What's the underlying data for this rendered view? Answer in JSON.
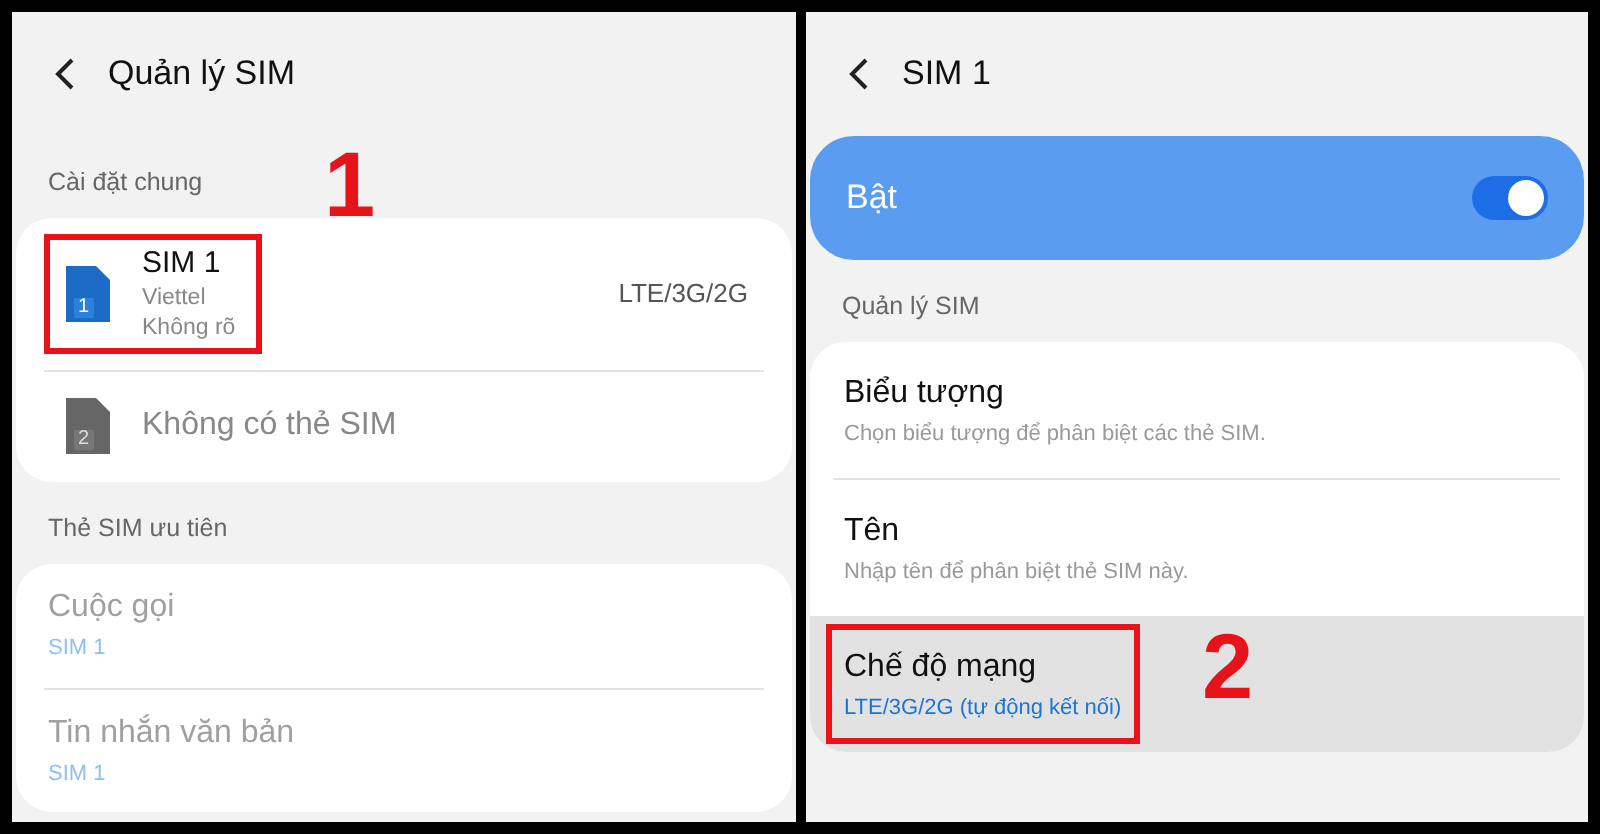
{
  "left_screen": {
    "title": "Quản lý SIM",
    "sections": [
      {
        "header": "Cài đặt chung",
        "items": [
          {
            "kind": "sim",
            "name": "SIM 1",
            "icon_number": "1",
            "lines": [
              "Viettel",
              "Không rõ"
            ],
            "network": "LTE/3G/2G",
            "active": true,
            "callout": "1"
          },
          {
            "kind": "sim",
            "name": "Không có thẻ SIM",
            "icon_number": "2",
            "active": false
          }
        ]
      },
      {
        "header": "Thẻ SIM ưu tiên",
        "items": [
          {
            "kind": "pref",
            "name": "Cuộc gọi",
            "value": "SIM 1",
            "disabled": true
          },
          {
            "kind": "pref",
            "name": "Tin nhắn văn bản",
            "value": "SIM 1",
            "disabled": true
          }
        ]
      }
    ]
  },
  "right_screen": {
    "title": "SIM 1",
    "toggle": {
      "label": "Bật",
      "on": true
    },
    "section": {
      "header": "Quản lý SIM",
      "items": [
        {
          "title": "Biểu tượng",
          "subtitle": "Chọn biểu tượng để phân biệt các thẻ SIM.",
          "selected": false
        },
        {
          "title": "Tên",
          "subtitle": "Nhập tên để phân biệt thẻ SIM này.",
          "selected": false
        },
        {
          "title": "Chế độ mạng",
          "subtitle": "LTE/3G/2G (tự động kết nối)",
          "selected": true,
          "callout": "2"
        }
      ]
    }
  }
}
